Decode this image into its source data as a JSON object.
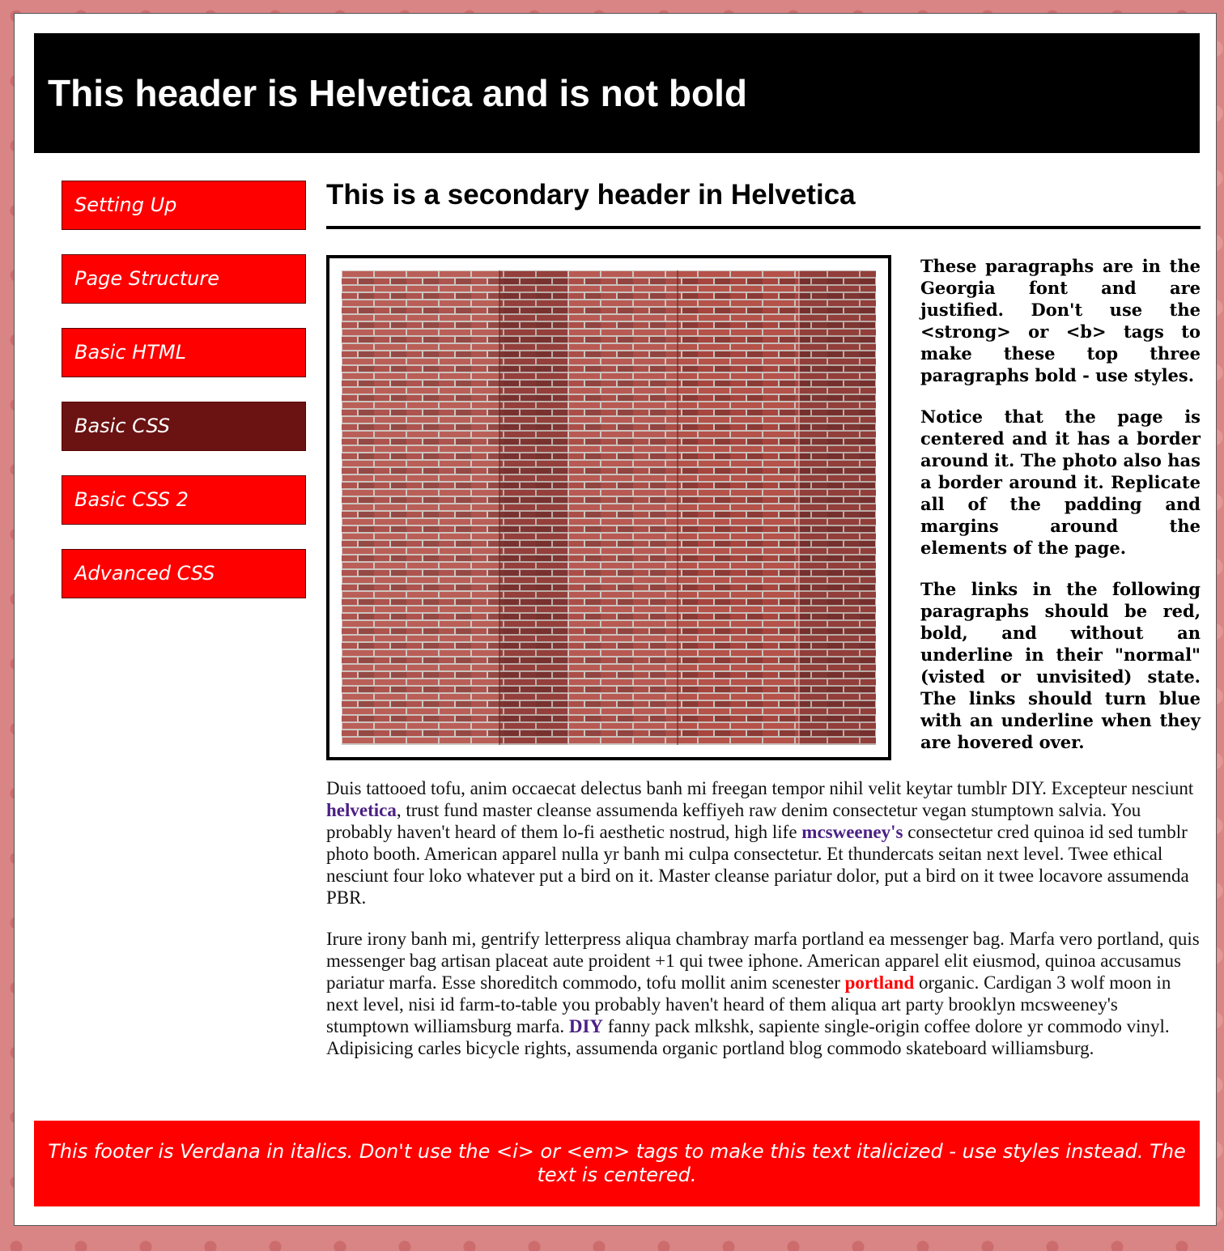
{
  "header": {
    "title": "This header is Helvetica and is not bold"
  },
  "nav": {
    "items": [
      {
        "label": "Setting Up"
      },
      {
        "label": "Page Structure"
      },
      {
        "label": "Basic HTML"
      },
      {
        "label": "Basic CSS"
      },
      {
        "label": "Basic CSS 2"
      },
      {
        "label": "Advanced CSS"
      }
    ],
    "active_index": 3
  },
  "main": {
    "title": "This is a secondary header in Helvetica",
    "intro": [
      "These paragraphs are in the Georgia font and are justified. Don't use the <strong> or <b> tags to make these top three paragraphs bold - use styles.",
      "Notice that the page is centered and it has a border around it. The photo also has a border around it. Replicate all of the padding and margins around the elements of the page.",
      "The links in the following paragraphs should be red, bold, and without an underline in their \"normal\" (visted or unvisited) state. The links should turn blue with an underline when they are hovered over."
    ],
    "paragraph1": {
      "t1": "Duis tattooed tofu, anim occaecat delectus banh mi freegan tempor nihil velit keytar tumblr DIY. Excepteur nesciunt ",
      "link1": "helvetica",
      "t2": ", trust fund master cleanse assumenda keffiyeh raw denim consectetur vegan stumptown salvia. You probably haven't heard of them lo-fi aesthetic nostrud, high life ",
      "link2": "mcsweeney's",
      "t3": " consectetur cred quinoa id sed tumblr photo booth. American apparel nulla yr banh mi culpa consectetur. Et thundercats seitan next level. Twee ethical nesciunt four loko whatever put a bird on it. Master cleanse pariatur dolor, put a bird on it twee locavore assumenda PBR."
    },
    "paragraph2": {
      "t1": "Irure irony banh mi, gentrify letterpress aliqua chambray marfa portland ea messenger bag. Marfa vero portland, quis messenger bag artisan placeat aute proident +1 qui twee iphone. American apparel elit eiusmod, quinoa accusamus pariatur marfa. Esse shoreditch commodo, tofu mollit anim scenester ",
      "link1": "portland",
      "t2": " organic. Cardigan 3 wolf moon in next level, nisi id farm-to-table you probably haven't heard of them aliqua art party brooklyn mcsweeney's stumptown williamsburg marfa. ",
      "link2": "DIY",
      "t3": " fanny pack mlkshk, sapiente single-origin coffee dolore yr commodo vinyl. Adipisicing carles bicycle rights, assumenda organic portland blog commodo skateboard williamsburg."
    }
  },
  "footer": {
    "text": "This footer is Verdana in italics. Don't use the <i> or <em> tags to make this text italicized - use styles instead. The text is centered."
  },
  "colors": {
    "header_bg": "#000000",
    "nav_bg": "#ff0000",
    "nav_active_bg": "#6b1212",
    "footer_bg": "#ff0000",
    "link_visited": "#4b2085",
    "link_red": "#ff0000",
    "page_bg": "#d98585"
  }
}
